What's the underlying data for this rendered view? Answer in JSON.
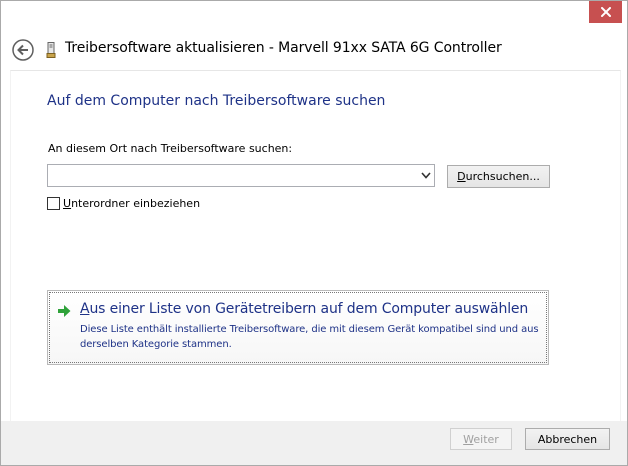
{
  "window": {
    "title": "Treibersoftware aktualisieren - Marvell 91xx SATA 6G Controller",
    "close_icon": "close-icon",
    "back_icon": "back-arrow-icon",
    "device_icon": "device-icon"
  },
  "main": {
    "heading": "Auf dem Computer nach Treibersoftware suchen",
    "path_label": "An diesem Ort nach Treibersoftware suchen:",
    "path_value": "",
    "browse_button": {
      "mnemonic": "D",
      "rest": "urchsuchen..."
    },
    "subfolder_checkbox": {
      "mnemonic": "U",
      "rest": "nterordner einbeziehen",
      "checked": false
    },
    "pick_from_list": {
      "title_mnemonic": "A",
      "title_rest": "us einer Liste von Gerätetreibern auf dem Computer auswählen",
      "description": "Diese Liste enthält installierte Treibersoftware, die mit diesem Gerät kompatibel sind und aus derselben Kategorie stammen.",
      "icon": "green-arrow-icon"
    }
  },
  "footer": {
    "next_button": {
      "mnemonic": "W",
      "rest": "eiter",
      "enabled": false
    },
    "cancel_button": "Abbrechen"
  },
  "colors": {
    "heading_blue": "#1e3287",
    "close_red": "#c75050",
    "arrow_green": "#2fa23a",
    "footer_gray": "#f0f0f0"
  }
}
